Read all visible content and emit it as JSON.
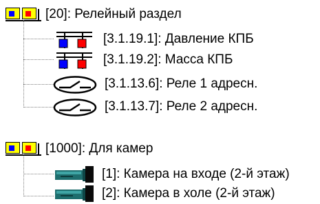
{
  "groups": [
    {
      "label": "[20]: Релейный раздел",
      "icon": "partition-icon",
      "children": [
        {
          "label": "[3.1.19.1]: Давление КПБ",
          "icon": "relay-output-icon"
        },
        {
          "label": "[3.1.19.2]: Масса КПБ",
          "icon": "relay-output-icon"
        },
        {
          "label": "[3.1.13.6]: Реле 1 адресн.",
          "icon": "relay-switch-icon"
        },
        {
          "label": "[3.1.13.7]: Реле 2 адресн.",
          "icon": "relay-switch-icon"
        }
      ]
    },
    {
      "label": "[1000]: Для камер",
      "icon": "partition-icon",
      "children": [
        {
          "label": "[1]: Камера на входе (2-й этаж)",
          "icon": "camera-icon"
        },
        {
          "label": "[2]: Камера в холе (2-й этаж)",
          "icon": "camera-icon"
        }
      ]
    }
  ],
  "colors": {
    "partition_blue": "#0000ff",
    "partition_red": "#ff0000",
    "partition_yellow": "#ffff00",
    "camera_teal": "#1e6e6e"
  }
}
